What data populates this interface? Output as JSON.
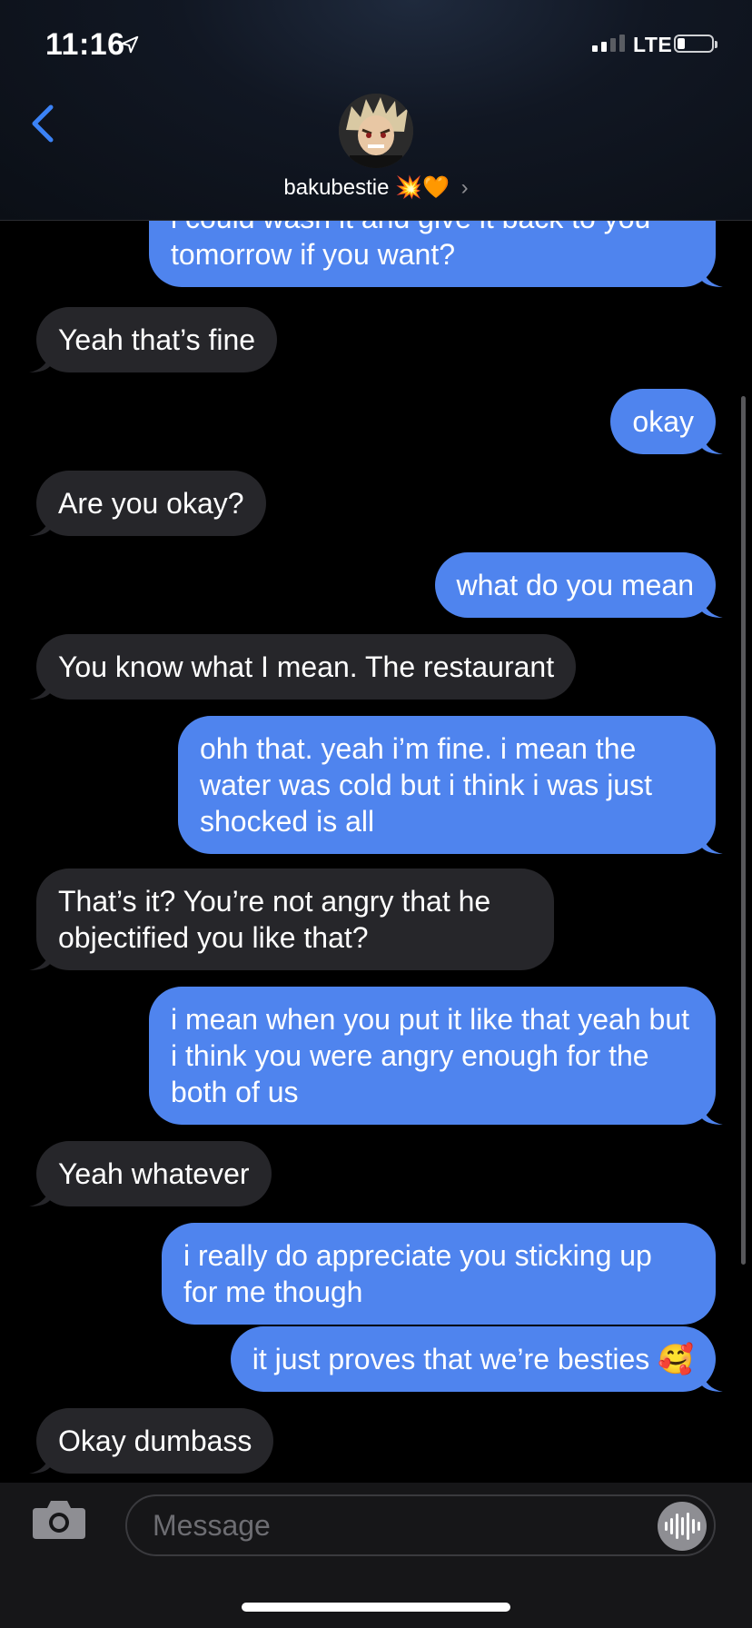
{
  "status_bar": {
    "time": "11:16",
    "network": "LTE"
  },
  "header": {
    "contact_name": "bakubestie",
    "contact_emoji": "💥🧡",
    "chevron": "›"
  },
  "messages": [
    {
      "side": "out",
      "text": "i could wash it and give it back to you tomorrow if you want?"
    },
    {
      "side": "in",
      "text": "Yeah that’s fine"
    },
    {
      "side": "out",
      "text": "okay"
    },
    {
      "side": "in",
      "text": "Are you okay?"
    },
    {
      "side": "out",
      "text": "what do you mean"
    },
    {
      "side": "in",
      "text": "You know what I mean. The restaurant"
    },
    {
      "side": "out",
      "text": "ohh that. yeah i’m fine. i mean the water was cold but i think i was just shocked is all"
    },
    {
      "side": "in",
      "text": "That’s it? You’re not angry that he objectified you like that?"
    },
    {
      "side": "out",
      "text": "i mean when you put it like that yeah but i think you were angry enough for the both of us"
    },
    {
      "side": "in",
      "text": "Yeah whatever"
    },
    {
      "side": "out",
      "text": "i really do appreciate you sticking up for me though"
    },
    {
      "side": "out",
      "text": "it just proves that we’re besties 🥰"
    },
    {
      "side": "in",
      "text": "Okay dumbass"
    }
  ],
  "composer": {
    "placeholder": "Message"
  },
  "icons": {
    "back": "chevron-left-icon",
    "camera": "camera-icon",
    "voice": "waveform-icon",
    "location": "location-arrow-icon"
  },
  "colors": {
    "outgoing": "#4f84ee",
    "incoming": "#26262a",
    "accent": "#3b82f6"
  }
}
